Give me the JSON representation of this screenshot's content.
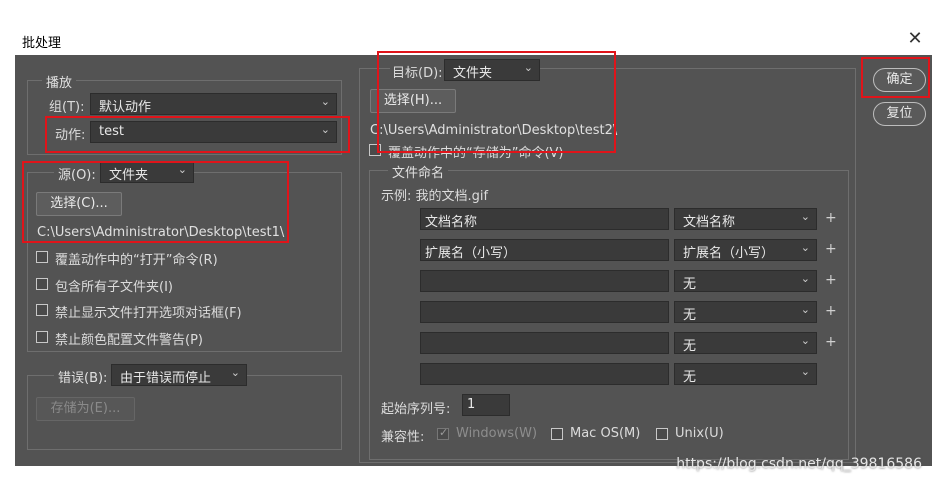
{
  "dialog": {
    "title": "批处理",
    "close_glyph": "✕"
  },
  "play": {
    "legend": "播放",
    "group_label": "组(T):",
    "group_value": "默认动作",
    "action_label": "动作:",
    "action_value": "test"
  },
  "source": {
    "label": "源(O):",
    "value": "文件夹",
    "choose_label": "选择(C)...",
    "path": "C:\\Users\\Administrator\\Desktop\\test1\\",
    "options": [
      {
        "label": "覆盖动作中的“打开”命令(R)",
        "checked": false
      },
      {
        "label": "包含所有子文件夹(I)",
        "checked": false
      },
      {
        "label": "禁止显示文件打开选项对话框(F)",
        "checked": false
      },
      {
        "label": "禁止颜色配置文件警告(P)",
        "checked": false
      }
    ]
  },
  "error": {
    "label": "错误(B):",
    "value": "由于错误而停止",
    "save_as_label": "存储为(E)..."
  },
  "target": {
    "label": "目标(D):",
    "value": "文件夹",
    "choose_label": "选择(H)...",
    "path": "C:\\Users\\Administrator\\Desktop\\test2\\",
    "override_label": "覆盖动作中的“存储为”命令(V)",
    "naming": {
      "legend": "文件命名",
      "example": "示例: 我的文档.gif",
      "rows": [
        {
          "text": "文档名称",
          "select": "文档名称",
          "plus": "+"
        },
        {
          "text": "扩展名（小写）",
          "select": "扩展名（小写）",
          "plus": "+"
        },
        {
          "text": "",
          "select": "无",
          "plus": "+"
        },
        {
          "text": "",
          "select": "无",
          "plus": "+"
        },
        {
          "text": "",
          "select": "无",
          "plus": "+"
        },
        {
          "text": "",
          "select": "无",
          "plus": ""
        }
      ],
      "serial_label": "起始序列号:",
      "serial_value": "1",
      "compat_label": "兼容性:",
      "compat": [
        {
          "label": "Windows(W)",
          "checked": true,
          "disabled": true
        },
        {
          "label": "Mac OS(M)",
          "checked": false,
          "disabled": false
        },
        {
          "label": "Unix(U)",
          "checked": false,
          "disabled": false
        }
      ]
    }
  },
  "buttons": {
    "ok": "确定",
    "reset": "复位"
  },
  "watermark": "https://blog.csdn.net/qq_39816586",
  "colors": {
    "panel": "#535353",
    "highlight": "#e0141a"
  }
}
